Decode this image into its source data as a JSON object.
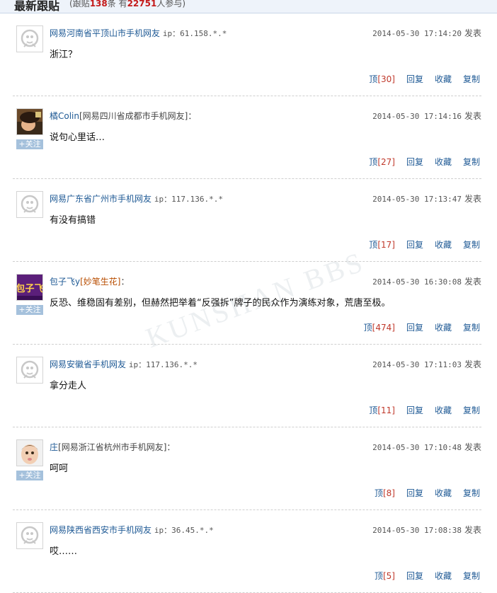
{
  "header": {
    "title": "最新跟贴",
    "stats_prefix": "(跟贴",
    "follow_count": "138",
    "stats_mid": "条 有",
    "participant_count": "22751",
    "stats_suffix": "人参与)"
  },
  "post_action_labels": {
    "up": "顶",
    "reply": "回复",
    "fav": "收藏",
    "copy": "复制",
    "publish": "发表",
    "follow": "+关注"
  },
  "posts": [
    {
      "user": "网易河南省平顶山市手机网友",
      "loc": "",
      "ip": "ip：61.158.*.*",
      "badge": "",
      "time": "2014-05-30 17:14:20",
      "content": "浙江？",
      "up": "[30]"
    },
    {
      "user": "橘Colin",
      "loc": "[网易四川省成都市手机网友]：",
      "ip": "",
      "badge": "",
      "time": "2014-05-30 17:14:16",
      "content": "说句心里话…",
      "up": "[27]"
    },
    {
      "user": "网易广东省广州市手机网友",
      "loc": "",
      "ip": "ip：117.136.*.*",
      "badge": "",
      "time": "2014-05-30 17:13:47",
      "content": "有没有搞错",
      "up": "[17]"
    },
    {
      "user": "包子飞y",
      "loc": "：",
      "ip": "",
      "badge": "[妙笔生花]",
      "time": "2014-05-30 16:30:08",
      "content": "反恐、维稳固有差别，但赫然把举着“反强拆”牌子的民众作为演练对象，荒唐至极。",
      "up": "[474]"
    },
    {
      "user": "网易安徽省手机网友",
      "loc": "",
      "ip": "ip：117.136.*.*",
      "badge": "",
      "time": "2014-05-30 17:11:03",
      "content": "拿分走人",
      "up": "[11]"
    },
    {
      "user": "庄",
      "loc": "[网易浙江省杭州市手机网友]：",
      "ip": "",
      "badge": "",
      "time": "2014-05-30 17:10:48",
      "content": "呵呵",
      "up": "[8]"
    },
    {
      "user": "网易陕西省西安市手机网友",
      "loc": "",
      "ip": "ip：36.45.*.*",
      "badge": "",
      "time": "2014-05-30 17:08:38",
      "content": "哎……",
      "up": "[5]"
    }
  ],
  "avatar_icons": [
    "default-avatar-icon",
    "photo-avatar",
    "default-avatar-icon",
    "brand-avatar",
    "default-avatar-icon",
    "child-photo-avatar",
    "default-avatar-icon"
  ],
  "watermark": "KUNSHAN BBS",
  "brand_avatar_text": "包子飞",
  "colors": {
    "link": "#1f5a95",
    "count": "#c0392b",
    "badge": "#b84d00",
    "follow_bg": "#a5c1dc"
  }
}
